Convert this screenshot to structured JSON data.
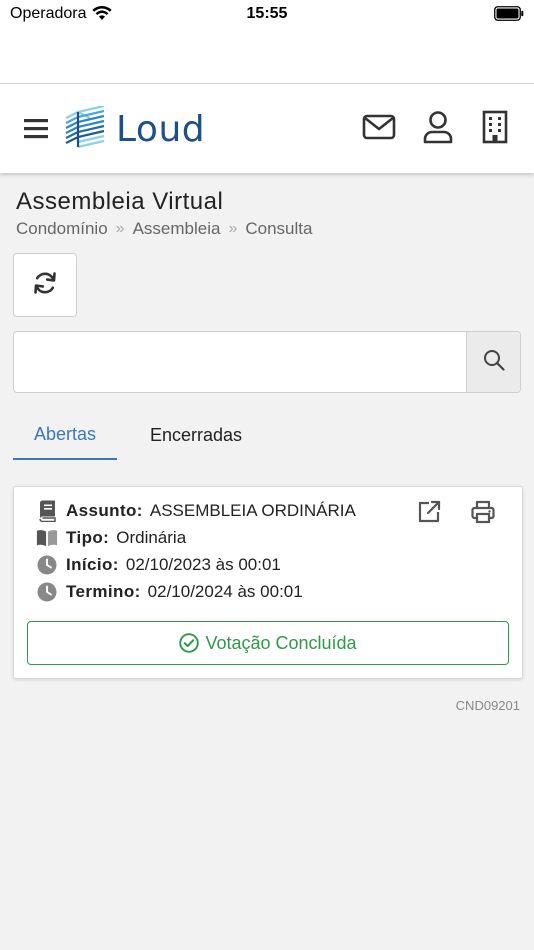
{
  "status_bar": {
    "carrier": "Operadora",
    "time": "15:55"
  },
  "header": {
    "logo_text": "Loud",
    "brand_color": "#1d4f8a",
    "icons": [
      "menu-icon",
      "mail-icon",
      "user-icon",
      "building-icon"
    ]
  },
  "page": {
    "title": "Assembleia Virtual",
    "breadcrumb": [
      "Condomínio",
      "Assembleia",
      "Consulta"
    ]
  },
  "search": {
    "placeholder": "",
    "value": ""
  },
  "tabs": [
    {
      "label": "Abertas",
      "active": true
    },
    {
      "label": "Encerradas",
      "active": false
    }
  ],
  "card": {
    "assunto_label": "Assunto:",
    "assunto_value": "ASSEMBLEIA ORDINÁRIA",
    "tipo_label": "Tipo:",
    "tipo_value": "Ordinária",
    "inicio_label": "Início:",
    "inicio_value": "02/10/2023 às 00:01",
    "termino_label": "Termino:",
    "termino_value": "02/10/2024 às 00:01",
    "status_label": "Votação Concluída",
    "status_color": "#2e9a48"
  },
  "footer": {
    "code": "CND09201"
  },
  "accent_color": "#3a78b5"
}
